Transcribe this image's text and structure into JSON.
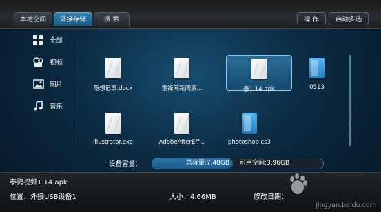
{
  "tabs": [
    {
      "label": "本地空间",
      "active": false
    },
    {
      "label": "外接存储",
      "active": true
    },
    {
      "label": "搜 索",
      "active": false
    }
  ],
  "actions": {
    "operate": "操 作",
    "multi_select": "启动多选"
  },
  "sidebar": [
    {
      "label": "全部",
      "icon": "grid-icon"
    },
    {
      "label": "视频",
      "icon": "film-reel-icon"
    },
    {
      "label": "图片",
      "icon": "picture-icon"
    },
    {
      "label": "音乐",
      "icon": "music-note-icon"
    }
  ],
  "files": [
    {
      "label": "随想记事.docx",
      "type": "document",
      "selected": false
    },
    {
      "label": "雷锋网新闻资...",
      "type": "document",
      "selected": false
    },
    {
      "label": "泰1.14.apk",
      "type": "document",
      "selected": true
    },
    {
      "label": "0513",
      "type": "folder",
      "selected": false
    },
    {
      "label": "illustrator.exe",
      "type": "document",
      "selected": false
    },
    {
      "label": "AdobeAfterEff...",
      "type": "document",
      "selected": false
    },
    {
      "label": "photoshop cs3",
      "type": "folder",
      "selected": false
    }
  ],
  "capacity": {
    "label": "设备容量：",
    "total": "总容量:7.48GB",
    "free": "可用空间:3.96GB",
    "used_fraction": 0.47
  },
  "info": {
    "name": "泰捷视频1.14.apk",
    "location": "位置：外接USB设备1",
    "size": "大小：4.66MB",
    "date": "修改日期："
  },
  "watermark": {
    "text": "jingyan.baidu.com"
  },
  "colors": {
    "accent": "#2f7fb3",
    "folder": "#3a9de0"
  }
}
